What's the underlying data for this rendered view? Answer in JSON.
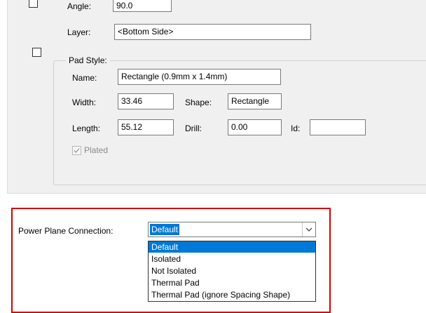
{
  "transform": {
    "angle_label": "Angle:",
    "angle_value": "90.0",
    "layer_label": "Layer:",
    "layer_value": "<Bottom Side>"
  },
  "pad_style": {
    "title": "Pad Style:",
    "name_label": "Name:",
    "name_value": "Rectangle (0.9mm x 1.4mm)",
    "width_label": "Width:",
    "width_value": "33.46",
    "shape_label": "Shape:",
    "shape_value": "Rectangle",
    "length_label": "Length:",
    "length_value": "55.12",
    "drill_label": "Drill:",
    "drill_value": "0.00",
    "id_label": "Id:",
    "id_value": "",
    "plated_label": "Plated",
    "plated_checked": true
  },
  "power_plane": {
    "label": "Power Plane Connection:",
    "selected": "Default",
    "options": [
      "Default",
      "Isolated",
      "Not Isolated",
      "Thermal Pad",
      "Thermal Pad (ignore Spacing Shape)"
    ]
  },
  "colors": {
    "highlight_frame": "#d40000",
    "selection": "#0078d7"
  }
}
